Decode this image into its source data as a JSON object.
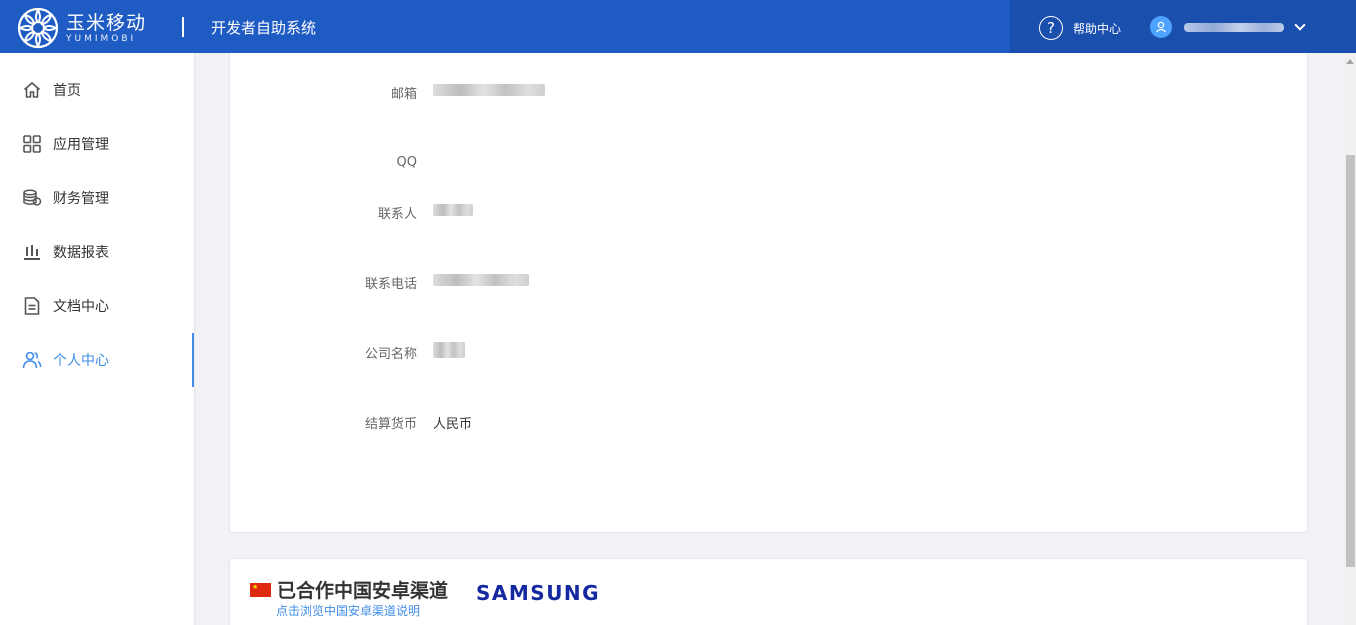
{
  "header": {
    "logo_cn": "玉米移动",
    "logo_en": "YUMIMOBI",
    "system_title": "开发者自助系统",
    "help_label": "帮助中心"
  },
  "sidebar": {
    "items": [
      {
        "label": "首页",
        "icon": "home-icon"
      },
      {
        "label": "应用管理",
        "icon": "apps-grid-icon"
      },
      {
        "label": "财务管理",
        "icon": "coins-icon"
      },
      {
        "label": "数据报表",
        "icon": "bar-chart-icon"
      },
      {
        "label": "文档中心",
        "icon": "document-icon"
      },
      {
        "label": "个人中心",
        "icon": "user-group-icon",
        "active": true
      }
    ]
  },
  "profile": {
    "fields": [
      {
        "label": "邮箱",
        "value": ""
      },
      {
        "label": "QQ",
        "value": ""
      },
      {
        "label": "联系人",
        "value": ""
      },
      {
        "label": "联系电话",
        "value": ""
      },
      {
        "label": "公司名称",
        "value": ""
      },
      {
        "label": "结算货币",
        "value": "人民币"
      }
    ]
  },
  "channels": {
    "title": "已合作中国安卓渠道",
    "link": "点击浏览中国安卓渠道说明",
    "partner": "SAMSUNG"
  },
  "colors": {
    "header_bg": "#1e5cc4",
    "accent": "#3f8de7",
    "samsung": "#1428a0"
  }
}
